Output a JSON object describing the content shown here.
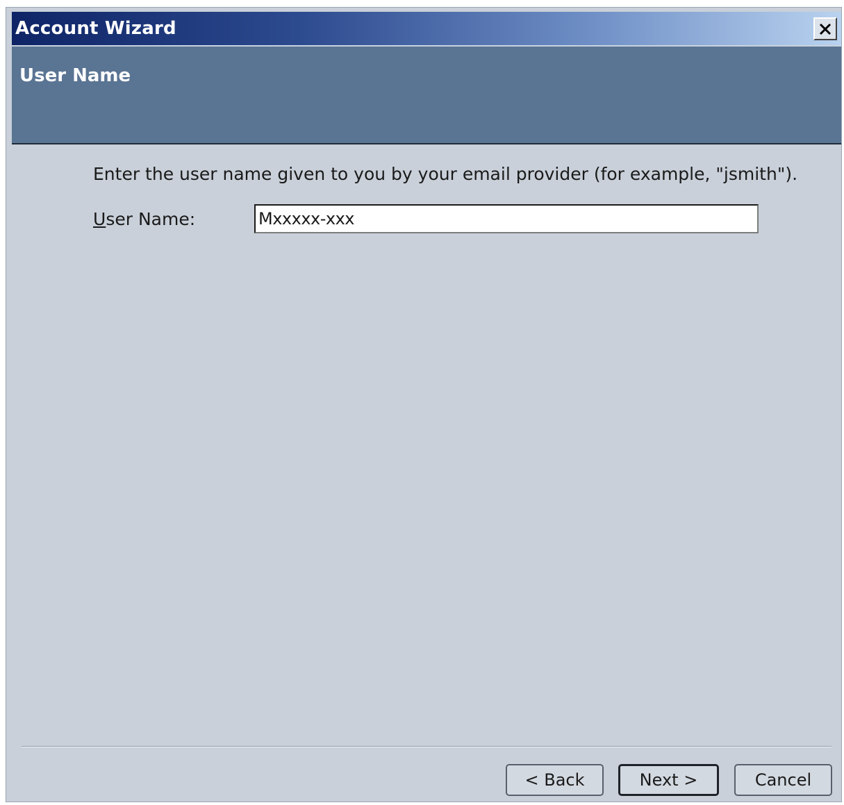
{
  "window": {
    "title": "Account Wizard",
    "close_icon": "close-icon"
  },
  "header": {
    "title": "User Name"
  },
  "content": {
    "instruction": "Enter the user name given to you by your email provider (for example, \"jsmith\").",
    "username_label_accesskey": "U",
    "username_label_rest": "ser Name:",
    "username_value": "Mxxxxx-xxx"
  },
  "buttons": {
    "back": "< Back",
    "next": "Next >",
    "cancel": "Cancel"
  },
  "colors": {
    "titlebar_start": "#0e2466",
    "titlebar_end": "#b9d2ef",
    "header_band": "#5a7493",
    "dialog_background": "#c9d0d9"
  }
}
